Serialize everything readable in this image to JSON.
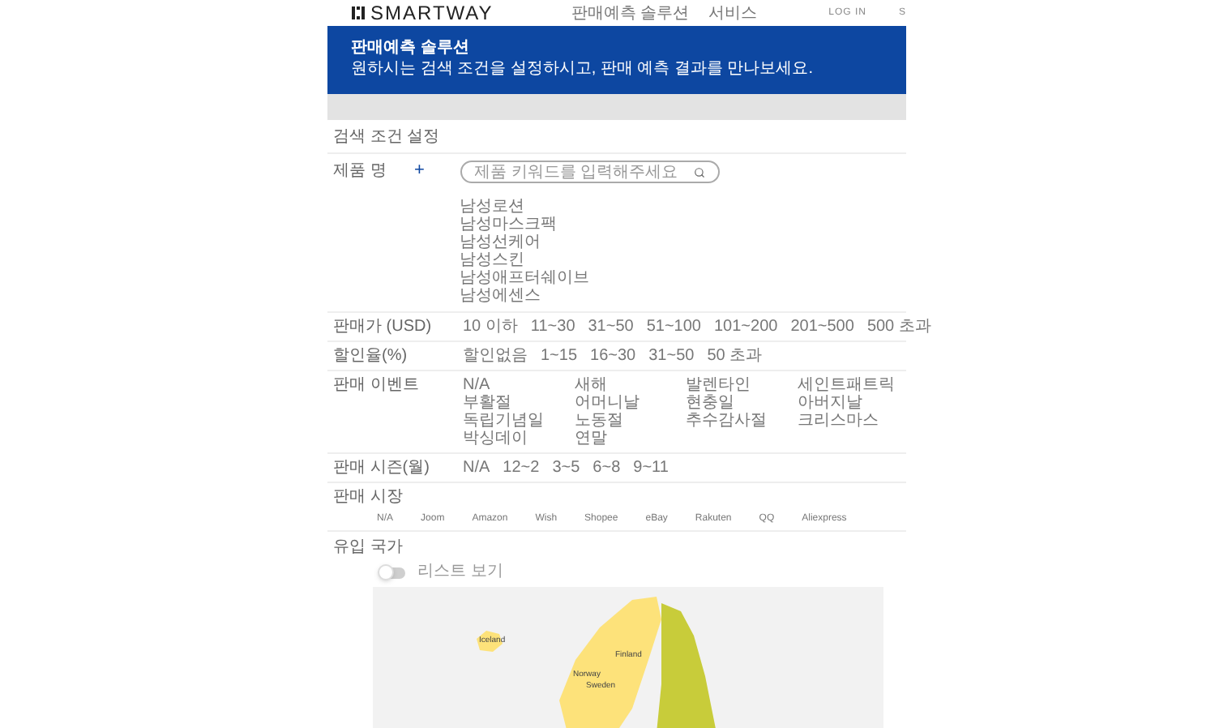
{
  "header": {
    "logo": "SMARTWAY",
    "nav": [
      {
        "label": "판매예측 솔루션"
      },
      {
        "label": "서비스"
      }
    ],
    "login": "LOG IN",
    "cut_link": "S"
  },
  "banner": {
    "title": "판매예측 솔루션",
    "subtitle": "원하시는 검색 조건을 설정하시고, 판매 예측 결과를 만나보세요."
  },
  "section_title": "검색 조건 설정",
  "product": {
    "label": "제품 명",
    "add": "+",
    "search": {
      "placeholder": "제품 키워드를 입력해주세요"
    },
    "items": [
      "남성로션",
      "남성마스크팩",
      "남성선케어",
      "남성스킨",
      "남성애프터쉐이브",
      "남성에센스"
    ]
  },
  "filters": [
    {
      "kind": "inline",
      "label": "판매가 (USD)",
      "options": [
        "10 이하",
        "11~30",
        "31~50",
        "51~100",
        "101~200",
        "201~500",
        "500 초과"
      ]
    },
    {
      "kind": "inline",
      "label": "할인율(%)",
      "options": [
        "할인없음",
        "1~15",
        "16~30",
        "31~50",
        "50 초과"
      ]
    },
    {
      "kind": "grid",
      "label": "판매 이벤트",
      "options": [
        "N/A",
        "새해",
        "발렌타인",
        "세인트패트릭",
        "부활절",
        "어머니날",
        "현충일",
        "아버지날",
        "독립기념일",
        "노동절",
        "추수감사절",
        "크리스마스",
        "박싱데이",
        "연말"
      ]
    },
    {
      "kind": "inline",
      "label": "판매 시즌(월)",
      "options": [
        "N/A",
        "12~2",
        "3~5",
        "6~8",
        "9~11"
      ]
    }
  ],
  "market": {
    "label": "판매 시장",
    "options": [
      "N/A",
      "Joom",
      "Amazon",
      "Wish",
      "Shopee",
      "eBay",
      "Rakuten",
      "QQ",
      "Aliexpress"
    ]
  },
  "country": {
    "label": "유입 국가",
    "list_toggle": {
      "label": "리스트 보기",
      "on": false
    },
    "map": {
      "labels": [
        "Iceland",
        "Finland",
        "Norway",
        "Sweden"
      ]
    }
  }
}
